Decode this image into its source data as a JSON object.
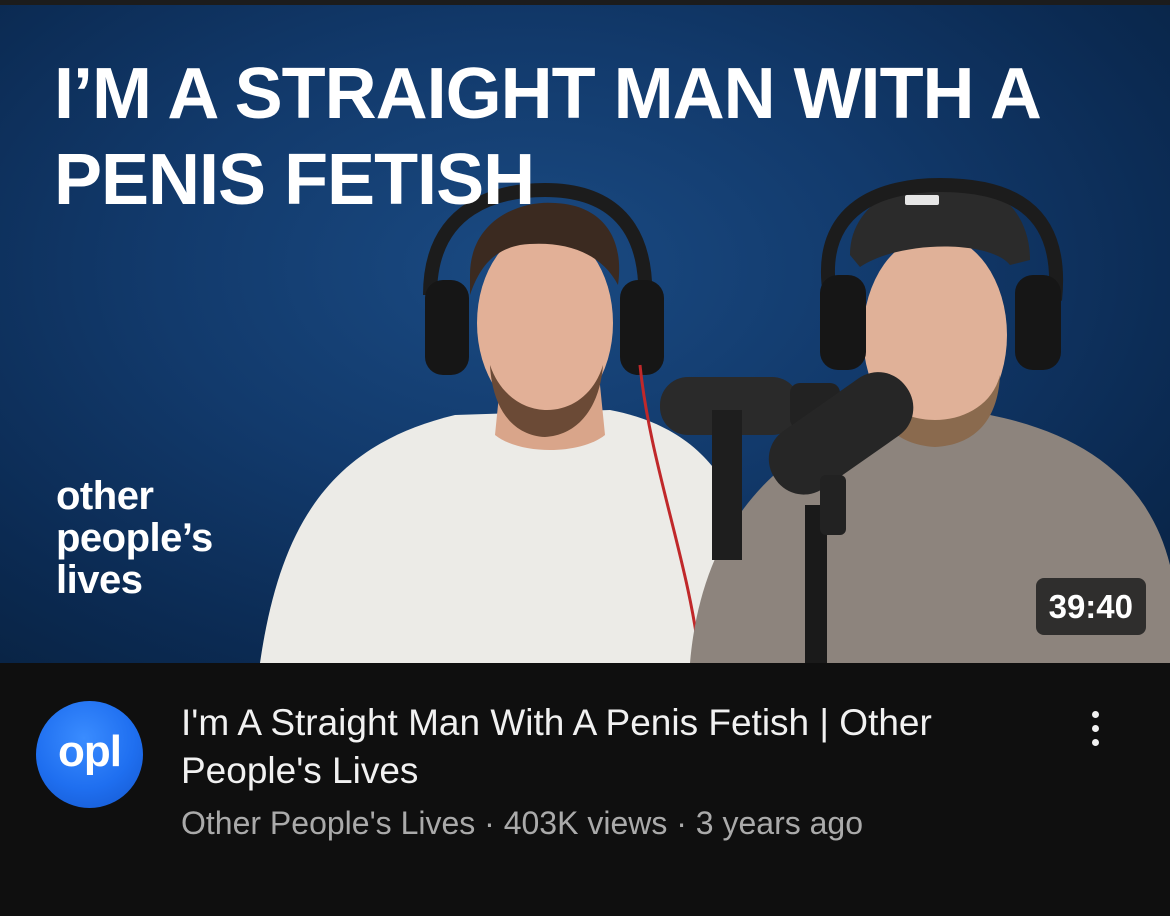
{
  "thumbnail": {
    "title_lines": [
      "I’M A STRAIGHT MAN WITH A",
      "PENIS FETISH"
    ],
    "brand_lines": [
      "other",
      "people’s",
      "lives"
    ],
    "duration": "39:40"
  },
  "video": {
    "title": "I'm A Straight Man With A Penis Fetish | Other People's Lives",
    "channel_avatar_text": "opl",
    "channel": "Other People's Lives",
    "views": "403K views",
    "age": "3 years ago",
    "separator": "·"
  },
  "icons": {
    "more": "more-vertical-icon"
  },
  "colors": {
    "background": "#0f0f0f",
    "thumbnail_bg": "#123a6c",
    "avatar": "#1f6ff0",
    "title_text": "#f1f1f1",
    "meta_text": "#aaaaaa"
  }
}
